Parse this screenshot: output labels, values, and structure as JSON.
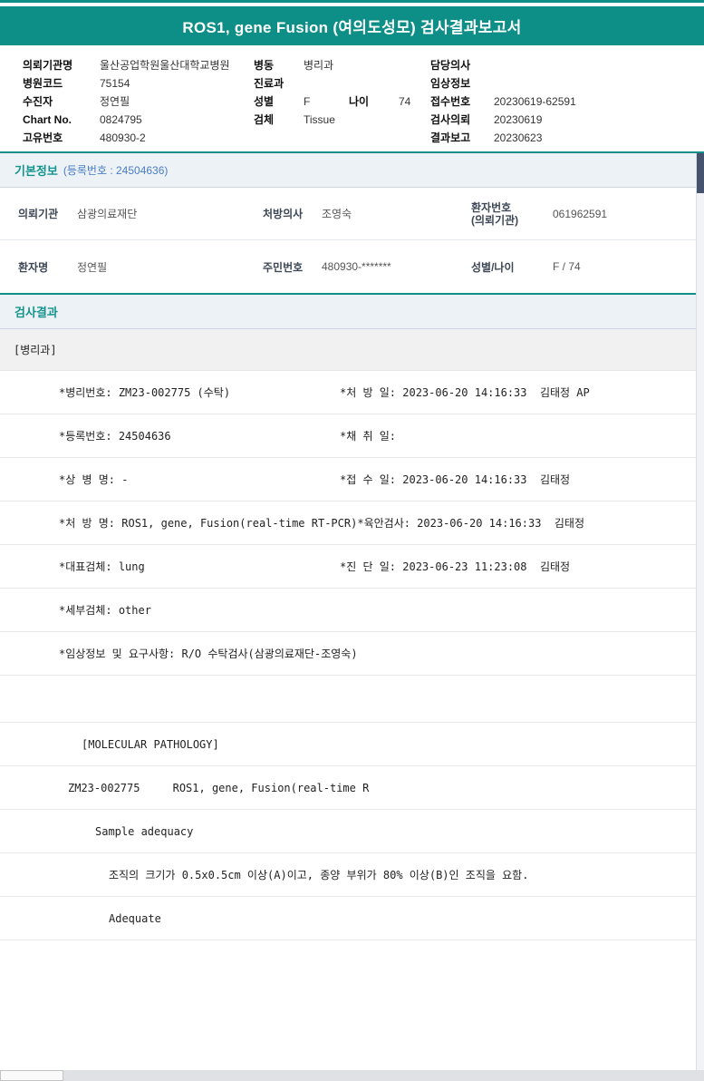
{
  "title": "ROS1, gene Fusion (여의도성모) 검사결과보고서",
  "colors": {
    "teal": "#0d8f88",
    "section_bg": "#edf2f7",
    "note_blue": "#4a7cc7",
    "scroll_thumb_navy": "#46536f"
  },
  "header": {
    "col1": [
      {
        "label": "의뢰기관명",
        "value": "울산공업학원울산대학교병원"
      },
      {
        "label": "병원코드",
        "value": "75154"
      },
      {
        "label": "수진자",
        "value": "정연필"
      },
      {
        "label": "Chart No.",
        "value": "0824795"
      },
      {
        "label": "고유번호",
        "value": "480930-2"
      }
    ],
    "col2": [
      {
        "label": "병동",
        "value": "병리과"
      },
      {
        "label": "진료과",
        "value": ""
      },
      {
        "label": "성별",
        "value": "F"
      },
      {
        "label": "검체",
        "value": "Tissue"
      }
    ],
    "age_label": "나이",
    "age_value": "74",
    "col3": [
      {
        "label": "담당의사",
        "value": ""
      },
      {
        "label": "임상정보",
        "value": ""
      },
      {
        "label": "접수번호",
        "value": "20230619-62591"
      },
      {
        "label": "검사의뢰",
        "value": "20230619"
      },
      {
        "label": "결과보고",
        "value": "20230623"
      }
    ]
  },
  "basic_info": {
    "section_title": "기본정보",
    "reg_note": "(등록번호 : 24504636)",
    "referrer_label": "의뢰기관",
    "referrer_value": "삼광의료재단",
    "doctor_label": "처방의사",
    "doctor_value": "조영숙",
    "patient_no_label_line1": "환자번호",
    "patient_no_label_line2": "(의뢰기관)",
    "patient_no_value": "061962591",
    "patient_name_label": "환자명",
    "patient_name_value": "정연필",
    "rrn_label": "주민번호",
    "rrn_value": "480930-*******",
    "sex_age_label": "성별/나이",
    "sex_age_value": "F / 74"
  },
  "results": {
    "section_title": "검사결과",
    "department": "[병리과]",
    "detail_rows": [
      {
        "left": "*병리번호: ZM23-002775 (수탁)",
        "right": "*처 방 일: 2023-06-20 14:16:33  김태정 AP"
      },
      {
        "left": "*등록번호: 24504636",
        "right": "*채 취 일:"
      },
      {
        "left": "*상 병 명: -",
        "right": "*접 수 일: 2023-06-20 14:16:33  김태정"
      },
      {
        "left": "*처 방 명: ROS1, gene, Fusion(real-time RT-PCR)",
        "right": "*육안검사: 2023-06-20 14:16:33  김태정"
      },
      {
        "left": "*대표검체: lung",
        "right": "*진 단 일: 2023-06-23 11:23:08  김태정"
      },
      {
        "left": "*세부검체: other",
        "right": ""
      },
      {
        "left": "*임상정보 및 요구사항: R/O 수탁검사(삼광의료재단-조영숙)",
        "right": ""
      }
    ],
    "molecular_rows": [
      "[MOLECULAR PATHOLOGY]",
      "ZM23-002775     ROS1, gene, Fusion(real-time R",
      "Sample adequacy",
      "조직의 크기가 0.5x0.5cm 이상(A)이고, 종양 부위가 80% 이상(B)인 조직을 요함.",
      "Adequate"
    ]
  }
}
